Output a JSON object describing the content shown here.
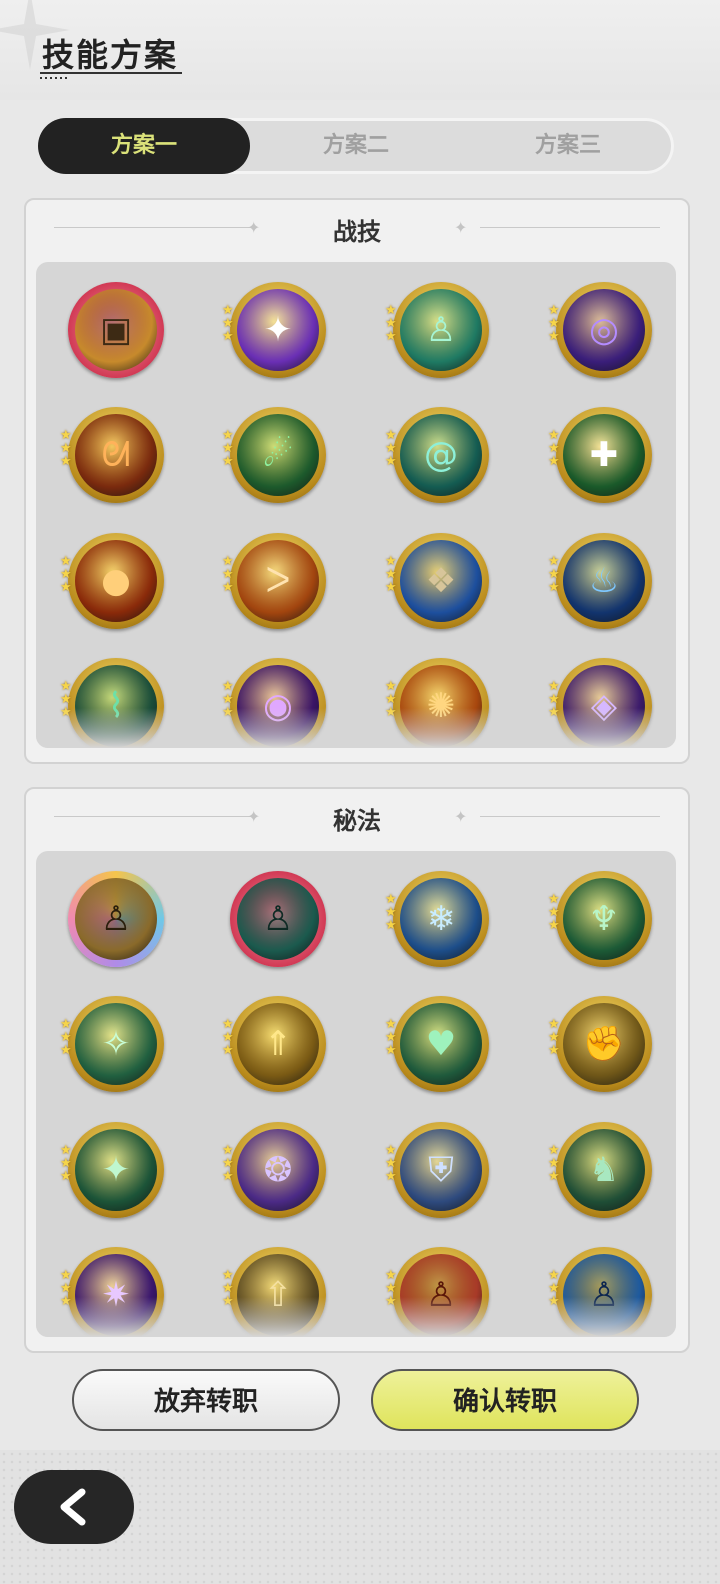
{
  "header": {
    "title": "技能方案"
  },
  "tabs": [
    {
      "label": "方案一",
      "active": true
    },
    {
      "label": "方案二",
      "active": false
    },
    {
      "label": "方案三",
      "active": false
    }
  ],
  "combat": {
    "title": "战技",
    "skills": [
      {
        "icon": "rock-golem-icon",
        "frame": "red",
        "bg": "#c78a2c",
        "fg": "#3d2a14",
        "glyph": "▣"
      },
      {
        "icon": "purple-star-icon",
        "frame": "gold",
        "bg": "#6a2fb5",
        "fg": "#ffffff",
        "glyph": "✦"
      },
      {
        "icon": "green-figure-icon",
        "frame": "gold",
        "bg": "#1f7a63",
        "fg": "#a6f5d4",
        "glyph": "♙"
      },
      {
        "icon": "purple-vortex-icon",
        "frame": "gold",
        "bg": "#3a1e7a",
        "fg": "#b48cff",
        "glyph": "◎"
      },
      {
        "icon": "fire-swirl-icon",
        "frame": "gold",
        "bg": "#7a2a0e",
        "fg": "#ffb25a",
        "glyph": "ᘛ"
      },
      {
        "icon": "green-comet-icon",
        "frame": "gold",
        "bg": "#1d5a2c",
        "fg": "#8ef2a1",
        "glyph": "☄"
      },
      {
        "icon": "teal-spiral-icon",
        "frame": "gold",
        "bg": "#145c52",
        "fg": "#8df0d9",
        "glyph": "@"
      },
      {
        "icon": "green-heal-icon",
        "frame": "gold",
        "bg": "#1a5a2a",
        "fg": "#ffffff",
        "glyph": "✚"
      },
      {
        "icon": "fireball-icon",
        "frame": "gold",
        "bg": "#8a2a0a",
        "fg": "#ffcf7a",
        "glyph": "●"
      },
      {
        "icon": "fire-wolf-icon",
        "frame": "gold",
        "bg": "#a2450f",
        "fg": "#ffe3b0",
        "glyph": "ᐳ"
      },
      {
        "icon": "blue-flame-golem-icon",
        "frame": "gold",
        "bg": "#1d4f9e",
        "fg": "#d7c59a",
        "glyph": "❖"
      },
      {
        "icon": "blue-flame-icon",
        "frame": "gold",
        "bg": "#12346e",
        "fg": "#7ec8ff",
        "glyph": "♨"
      },
      {
        "icon": "thorn-vine-icon",
        "frame": "gold",
        "bg": "#1a4d3a",
        "fg": "#6de0a8",
        "glyph": "⌇"
      },
      {
        "icon": "purple-eye-icon",
        "frame": "gold",
        "bg": "#3a1466",
        "fg": "#e0a8ff",
        "glyph": "◉"
      },
      {
        "icon": "flame-burst-icon",
        "frame": "gold",
        "bg": "#a8470e",
        "fg": "#ffd680",
        "glyph": "✺"
      },
      {
        "icon": "purple-rune-icon",
        "frame": "gold",
        "bg": "#3d1c6c",
        "fg": "#d6b8ff",
        "glyph": "◈"
      }
    ]
  },
  "secret": {
    "title": "秘法",
    "skills": [
      {
        "icon": "gold-figure-icon",
        "frame": "rainbow",
        "bg": "#8a6a2a",
        "fg": "#2a1e0c",
        "glyph": "♙"
      },
      {
        "icon": "teal-aura-figure-icon",
        "frame": "red",
        "bg": "#1b5a4e",
        "fg": "#0e2a24",
        "glyph": "♙"
      },
      {
        "icon": "ice-crystal-icon",
        "frame": "gold",
        "bg": "#1d4e8a",
        "fg": "#c8ecff",
        "glyph": "❄"
      },
      {
        "icon": "green-shrine-icon",
        "frame": "gold",
        "bg": "#1c5a36",
        "fg": "#b8f5c8",
        "glyph": "♆"
      },
      {
        "icon": "winged-emblem-icon",
        "frame": "gold",
        "bg": "#216040",
        "fg": "#c9ffd8",
        "glyph": "✧"
      },
      {
        "icon": "golden-arrow-icon",
        "frame": "gold",
        "bg": "#7a5a14",
        "fg": "#ffe78a",
        "glyph": "⇑"
      },
      {
        "icon": "green-heart-icon",
        "frame": "gold",
        "bg": "#1f5a3c",
        "fg": "#9ef2bd",
        "glyph": "♥"
      },
      {
        "icon": "golden-fist-icon",
        "frame": "gold",
        "bg": "#6e5618",
        "fg": "#f4d488",
        "glyph": "✊"
      },
      {
        "icon": "green-sparkle-icon",
        "frame": "gold",
        "bg": "#1c5438",
        "fg": "#bff7d0",
        "glyph": "✦"
      },
      {
        "icon": "purple-swirl-icon",
        "frame": "gold",
        "bg": "#4b2a86",
        "fg": "#d9c4ff",
        "glyph": "❂"
      },
      {
        "icon": "blue-armor-icon",
        "frame": "gold",
        "bg": "#2e4a7e",
        "fg": "#cfe0ff",
        "glyph": "⛨"
      },
      {
        "icon": "green-beast-icon",
        "frame": "gold",
        "bg": "#1f4e36",
        "fg": "#a8e8c0",
        "glyph": "♞"
      },
      {
        "icon": "purple-light-icon",
        "frame": "gold",
        "bg": "#3a176e",
        "fg": "#e8c8ff",
        "glyph": "✷"
      },
      {
        "icon": "golden-ascend-icon",
        "frame": "gold",
        "bg": "#5a4a22",
        "fg": "#f4e0a0",
        "glyph": "⇧"
      },
      {
        "icon": "red-figure-icon",
        "frame": "gold",
        "bg": "#a83a28",
        "fg": "#5a1608",
        "glyph": "♙"
      },
      {
        "icon": "blue-figure-icon",
        "frame": "gold",
        "bg": "#1e5a9e",
        "fg": "#0c2650",
        "glyph": "♙"
      }
    ]
  },
  "buttons": {
    "cancel": "放弃转职",
    "confirm": "确认转职"
  }
}
